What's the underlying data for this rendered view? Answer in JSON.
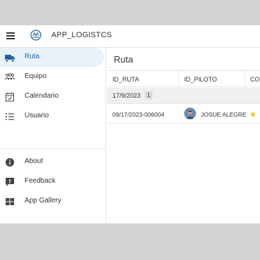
{
  "header": {
    "app_title": "APP_LOGISTCS"
  },
  "sidebar": {
    "items": [
      {
        "label": "Ruta",
        "icon": "truck-icon"
      },
      {
        "label": "Equipo",
        "icon": "team-icon"
      },
      {
        "label": "Calendario",
        "icon": "calendar-icon"
      },
      {
        "label": "Usuario",
        "icon": "list-icon"
      }
    ],
    "footer_items": [
      {
        "label": "About",
        "icon": "info-icon"
      },
      {
        "label": "Feedback",
        "icon": "feedback-icon"
      },
      {
        "label": "App Gallery",
        "icon": "grid-icon"
      }
    ]
  },
  "main": {
    "title": "Ruta",
    "columns": [
      "ID_RUTA",
      "ID_PILOTO",
      "COL"
    ],
    "group": {
      "label": "17/9/2023",
      "count": "1"
    },
    "rows": [
      {
        "id_ruta": "09/17/2023-006004",
        "id_piloto": "JOSUE ALEGRE"
      }
    ]
  },
  "colors": {
    "accent": "#1d5fa8",
    "active_bg": "#e9f1fb",
    "status_dot": "#f5d21a"
  }
}
